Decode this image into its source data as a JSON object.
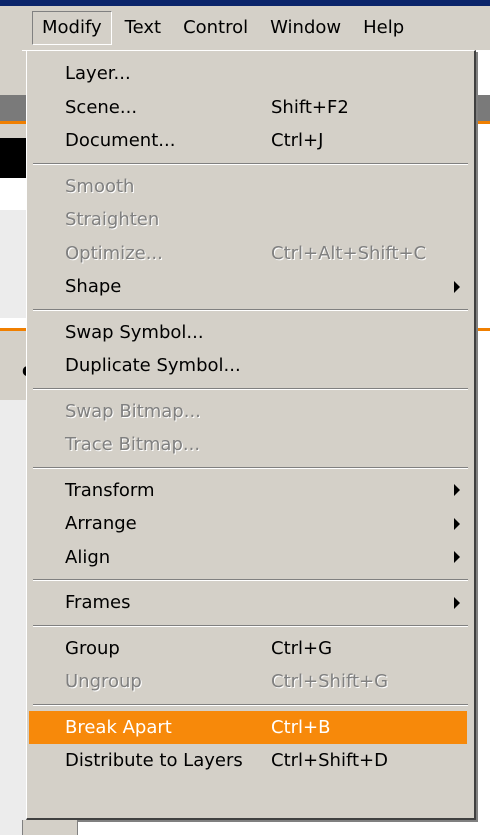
{
  "menubar": {
    "items": [
      {
        "label": "Modify"
      },
      {
        "label": "Text"
      },
      {
        "label": "Control"
      },
      {
        "label": "Window"
      },
      {
        "label": "Help"
      }
    ]
  },
  "menu": {
    "items": [
      {
        "label": "Layer...",
        "shortcut": ""
      },
      {
        "label": "Scene...",
        "shortcut": "Shift+F2"
      },
      {
        "label": "Document...",
        "shortcut": "Ctrl+J"
      },
      {
        "label": "Smooth",
        "shortcut": ""
      },
      {
        "label": "Straighten",
        "shortcut": ""
      },
      {
        "label": "Optimize...",
        "shortcut": "Ctrl+Alt+Shift+C"
      },
      {
        "label": "Shape",
        "shortcut": ""
      },
      {
        "label": "Swap Symbol...",
        "shortcut": ""
      },
      {
        "label": "Duplicate Symbol...",
        "shortcut": ""
      },
      {
        "label": "Swap Bitmap...",
        "shortcut": ""
      },
      {
        "label": "Trace Bitmap...",
        "shortcut": ""
      },
      {
        "label": "Transform",
        "shortcut": ""
      },
      {
        "label": "Arrange",
        "shortcut": ""
      },
      {
        "label": "Align",
        "shortcut": ""
      },
      {
        "label": "Frames",
        "shortcut": ""
      },
      {
        "label": "Group",
        "shortcut": "Ctrl+G"
      },
      {
        "label": "Ungroup",
        "shortcut": "Ctrl+Shift+G"
      },
      {
        "label": "Break Apart",
        "shortcut": "Ctrl+B"
      },
      {
        "label": "Distribute to Layers",
        "shortcut": "Ctrl+Shift+D"
      }
    ]
  },
  "background": {
    "fragment_text": "e"
  },
  "colors": {
    "menu_bg": "#d4d0c8",
    "highlight": "#f7890a",
    "disabled_text": "#808080",
    "accent_orange": "#f07f00"
  }
}
